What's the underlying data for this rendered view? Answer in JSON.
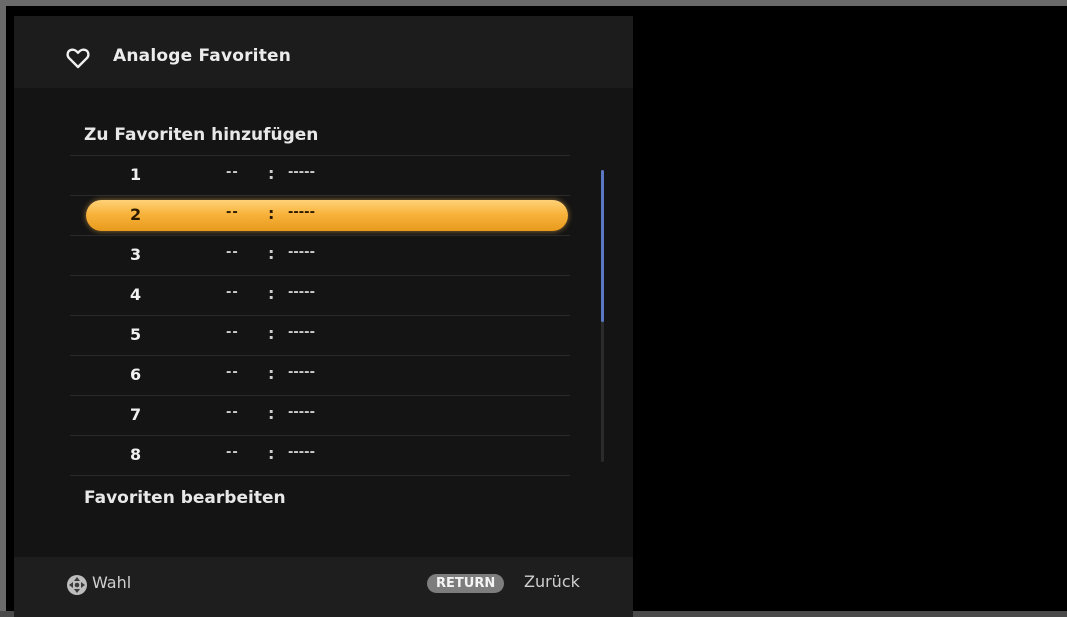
{
  "menu": {
    "title": "Analoge Favoriten",
    "title_icon": "heart-icon",
    "add_section_label": "Zu Favoriten hinzufügen",
    "edit_section_label": "Favoriten bearbeiten",
    "selected_index": 1,
    "slots": [
      {
        "number": "1",
        "channel": "--",
        "separator": ":",
        "name": "-----"
      },
      {
        "number": "2",
        "channel": "--",
        "separator": ":",
        "name": "-----"
      },
      {
        "number": "3",
        "channel": "--",
        "separator": ":",
        "name": "-----"
      },
      {
        "number": "4",
        "channel": "--",
        "separator": ":",
        "name": "-----"
      },
      {
        "number": "5",
        "channel": "--",
        "separator": ":",
        "name": "-----"
      },
      {
        "number": "6",
        "channel": "--",
        "separator": ":",
        "name": "-----"
      },
      {
        "number": "7",
        "channel": "--",
        "separator": ":",
        "name": "-----"
      },
      {
        "number": "8",
        "channel": "--",
        "separator": ":",
        "name": "-----"
      }
    ]
  },
  "footer": {
    "select_icon": "dpad-icon",
    "select_label": "Wahl",
    "return_key_label": "RETURN",
    "back_label": "Zurück"
  },
  "colors": {
    "highlight": "#f8b33c",
    "scroll_thumb": "#5b78c4"
  }
}
